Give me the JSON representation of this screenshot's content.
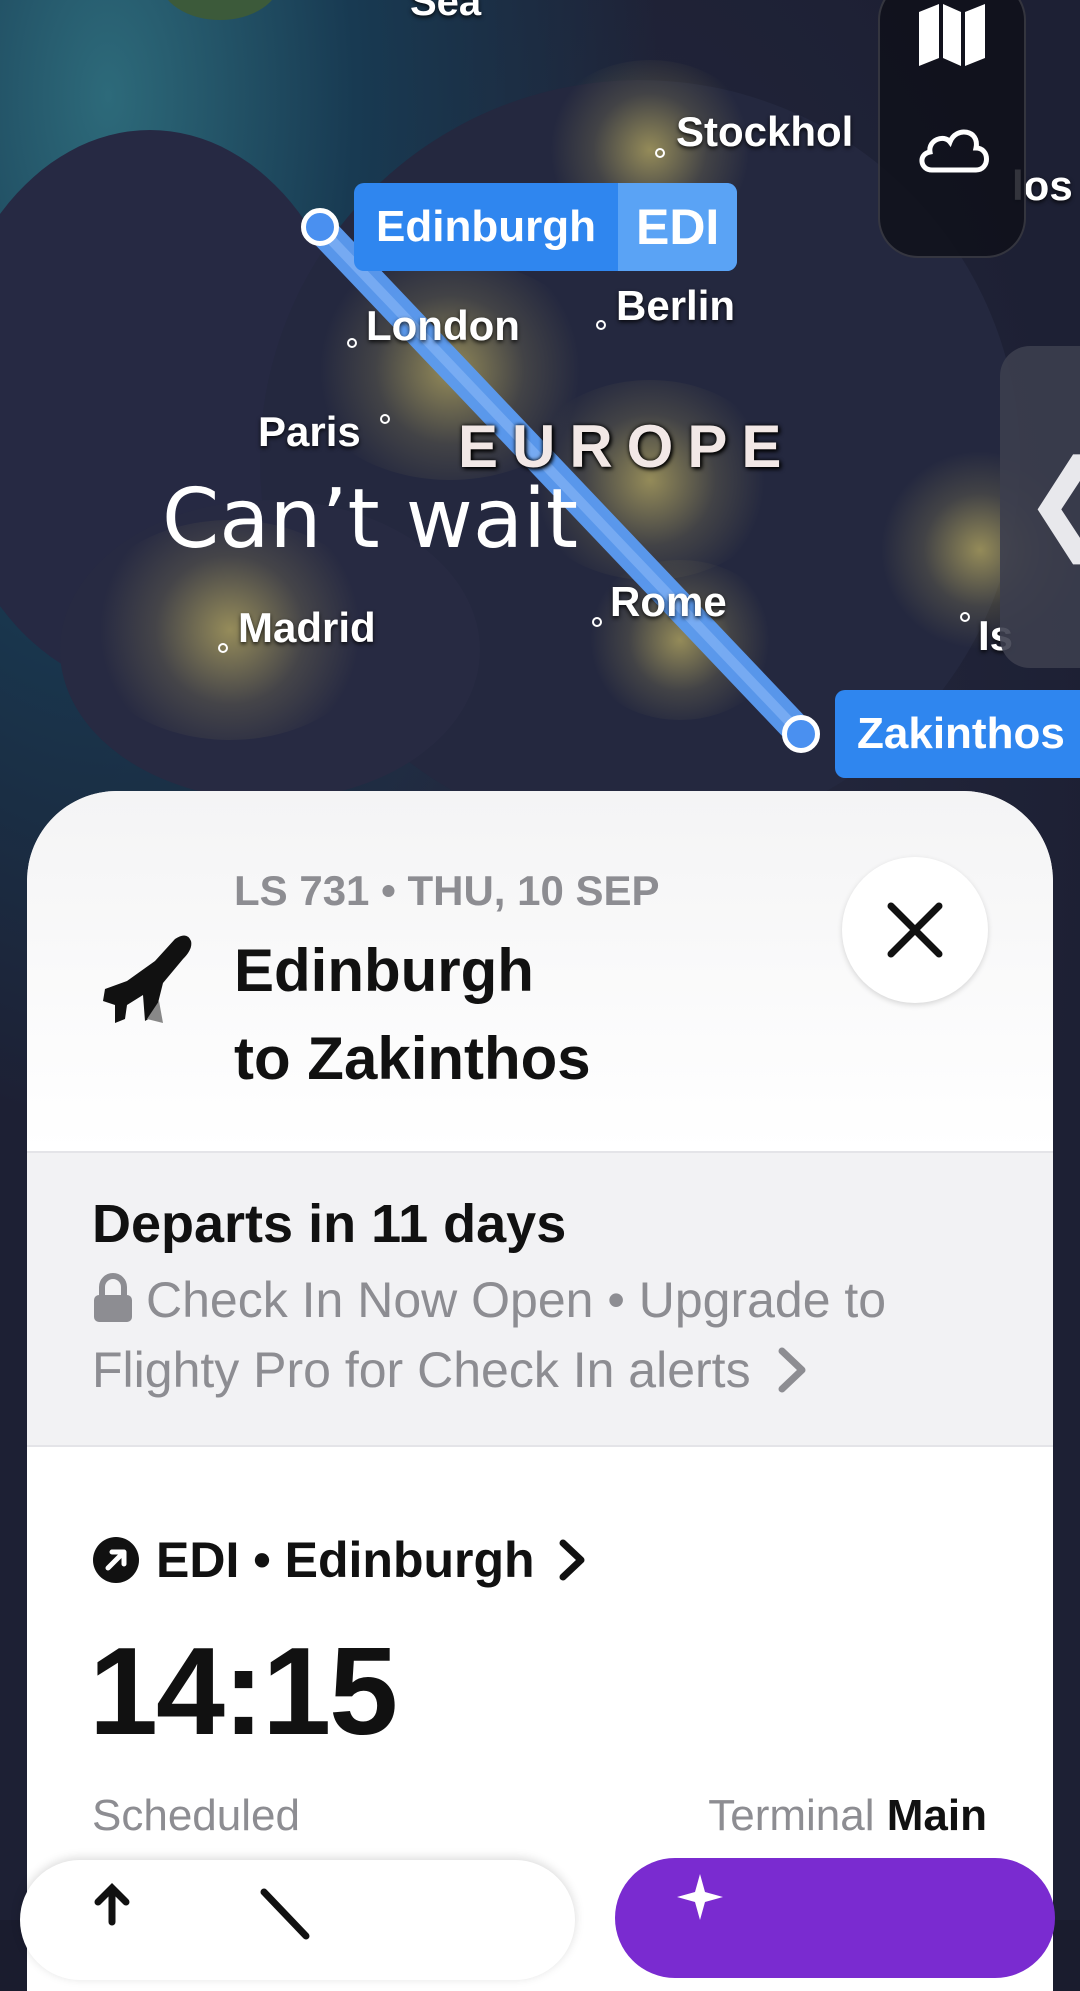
{
  "map": {
    "cities": {
      "stockholm": "Stockhol",
      "london": "London",
      "berlin": "Berlin",
      "paris": "Paris",
      "madrid": "Madrid",
      "rome": "Rome",
      "istanbul_partial": "Is",
      "oslo_partial": "los",
      "sea_partial": "Sea"
    },
    "region_label": "EUROPE",
    "note": "Can’t wait",
    "origin_tag": {
      "name": "Edinburgh",
      "code": "EDI"
    },
    "destination_tag": {
      "name": "Zakinthos"
    },
    "route_color": "#5b9cf4",
    "controls": {
      "map_icon": "map-icon",
      "weather_icon": "cloud-icon"
    }
  },
  "sheet": {
    "flight_line": "LS 731 • THU, 10 SEP",
    "title_line1": "Edinburgh",
    "title_line2": "to Zakinthos",
    "departs": "Departs in 11 days",
    "checkin_notice": "Check In Now Open • Upgrade to Flighty Pro for Check In alerts",
    "departure_airport": "EDI • Edinburgh",
    "departure_time": "14:15",
    "departure_status": "Scheduled",
    "terminal_label": "Terminal",
    "terminal_value": "Main"
  },
  "colors": {
    "accent": "#2f86ef",
    "pro": "#7a2bd0"
  }
}
